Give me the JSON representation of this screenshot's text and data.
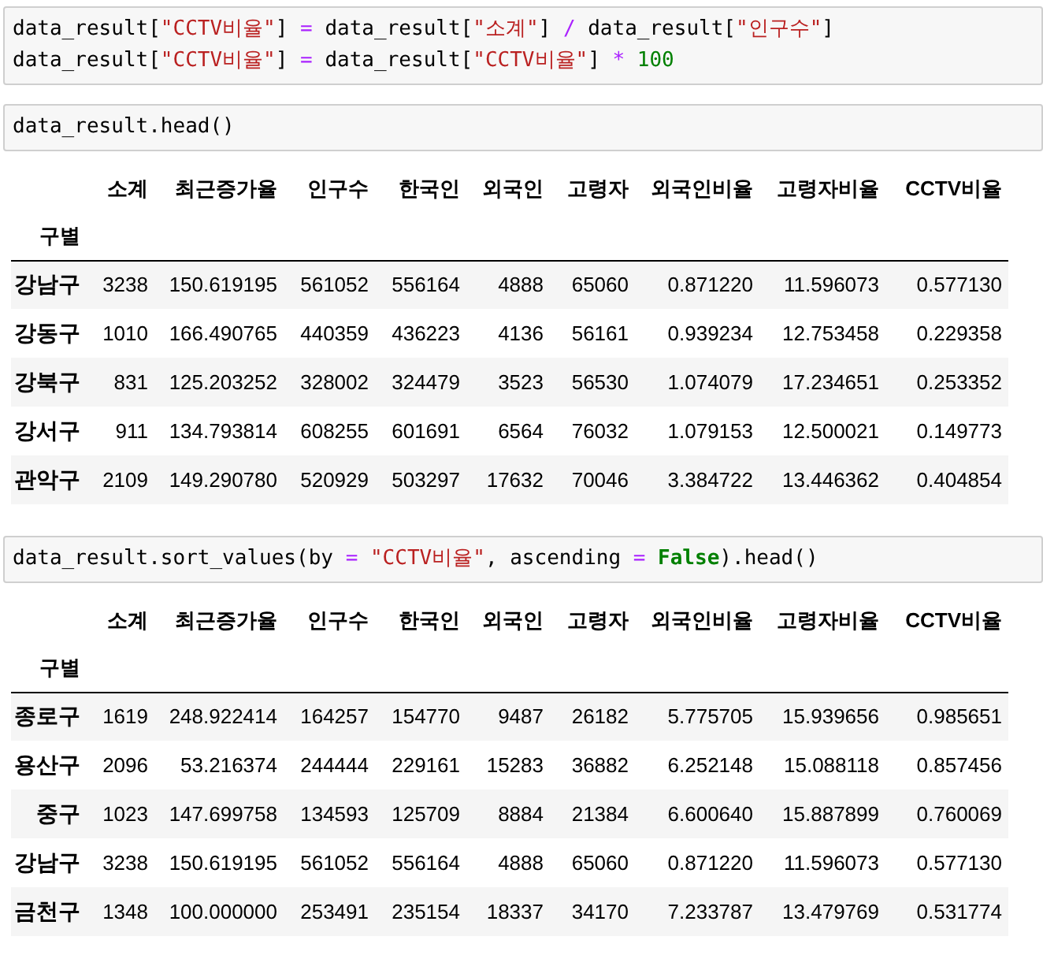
{
  "cells": [
    {
      "kind": "code",
      "lines": [
        [
          {
            "kind": "plain",
            "text": "data_result["
          },
          {
            "kind": "string",
            "text": "\"CCTV비율\""
          },
          {
            "kind": "plain",
            "text": "] "
          },
          {
            "kind": "operator",
            "text": "="
          },
          {
            "kind": "plain",
            "text": " data_result["
          },
          {
            "kind": "string",
            "text": "\"소계\""
          },
          {
            "kind": "plain",
            "text": "] "
          },
          {
            "kind": "operator",
            "text": "/"
          },
          {
            "kind": "plain",
            "text": " data_result["
          },
          {
            "kind": "string",
            "text": "\"인구수\""
          },
          {
            "kind": "plain",
            "text": "]"
          }
        ],
        [
          {
            "kind": "plain",
            "text": "data_result["
          },
          {
            "kind": "string",
            "text": "\"CCTV비율\""
          },
          {
            "kind": "plain",
            "text": "] "
          },
          {
            "kind": "operator",
            "text": "="
          },
          {
            "kind": "plain",
            "text": " data_result["
          },
          {
            "kind": "string",
            "text": "\"CCTV비율\""
          },
          {
            "kind": "plain",
            "text": "] "
          },
          {
            "kind": "operator",
            "text": "*"
          },
          {
            "kind": "number",
            "text": " 100"
          }
        ]
      ]
    },
    {
      "kind": "code",
      "lines": [
        [
          {
            "kind": "plain",
            "text": "data_result.head()"
          }
        ]
      ]
    },
    {
      "kind": "table",
      "columns": [
        "소계",
        "최근증가율",
        "인구수",
        "한국인",
        "외국인",
        "고령자",
        "외국인비율",
        "고령자비율",
        "CCTV비율"
      ],
      "index_name": "구별",
      "rows": [
        {
          "index": "강남구",
          "values": [
            "3238",
            "150.619195",
            "561052",
            "556164",
            "4888",
            "65060",
            "0.871220",
            "11.596073",
            "0.577130"
          ]
        },
        {
          "index": "강동구",
          "values": [
            "1010",
            "166.490765",
            "440359",
            "436223",
            "4136",
            "56161",
            "0.939234",
            "12.753458",
            "0.229358"
          ]
        },
        {
          "index": "강북구",
          "values": [
            "831",
            "125.203252",
            "328002",
            "324479",
            "3523",
            "56530",
            "1.074079",
            "17.234651",
            "0.253352"
          ]
        },
        {
          "index": "강서구",
          "values": [
            "911",
            "134.793814",
            "608255",
            "601691",
            "6564",
            "76032",
            "1.079153",
            "12.500021",
            "0.149773"
          ]
        },
        {
          "index": "관악구",
          "values": [
            "2109",
            "149.290780",
            "520929",
            "503297",
            "17632",
            "70046",
            "3.384722",
            "13.446362",
            "0.404854"
          ]
        }
      ]
    },
    {
      "kind": "code",
      "lines": [
        [
          {
            "kind": "plain",
            "text": "data_result.sort_values(by "
          },
          {
            "kind": "operator",
            "text": "= "
          },
          {
            "kind": "string",
            "text": "\"CCTV비율\""
          },
          {
            "kind": "plain",
            "text": ", ascending "
          },
          {
            "kind": "operator",
            "text": "= "
          },
          {
            "kind": "keyword",
            "text": "False"
          },
          {
            "kind": "plain",
            "text": ").head()"
          }
        ]
      ]
    },
    {
      "kind": "table",
      "columns": [
        "소계",
        "최근증가율",
        "인구수",
        "한국인",
        "외국인",
        "고령자",
        "외국인비율",
        "고령자비율",
        "CCTV비율"
      ],
      "index_name": "구별",
      "rows": [
        {
          "index": "종로구",
          "values": [
            "1619",
            "248.922414",
            "164257",
            "154770",
            "9487",
            "26182",
            "5.775705",
            "15.939656",
            "0.985651"
          ]
        },
        {
          "index": "용산구",
          "values": [
            "2096",
            "53.216374",
            "244444",
            "229161",
            "15283",
            "36882",
            "6.252148",
            "15.088118",
            "0.857456"
          ]
        },
        {
          "index": "중구",
          "values": [
            "1023",
            "147.699758",
            "134593",
            "125709",
            "8884",
            "21384",
            "6.600640",
            "15.887899",
            "0.760069"
          ]
        },
        {
          "index": "강남구",
          "values": [
            "3238",
            "150.619195",
            "561052",
            "556164",
            "4888",
            "65060",
            "0.871220",
            "11.596073",
            "0.577130"
          ]
        },
        {
          "index": "금천구",
          "values": [
            "1348",
            "100.000000",
            "253491",
            "235154",
            "18337",
            "34170",
            "7.233787",
            "13.479769",
            "0.531774"
          ]
        }
      ]
    }
  ]
}
